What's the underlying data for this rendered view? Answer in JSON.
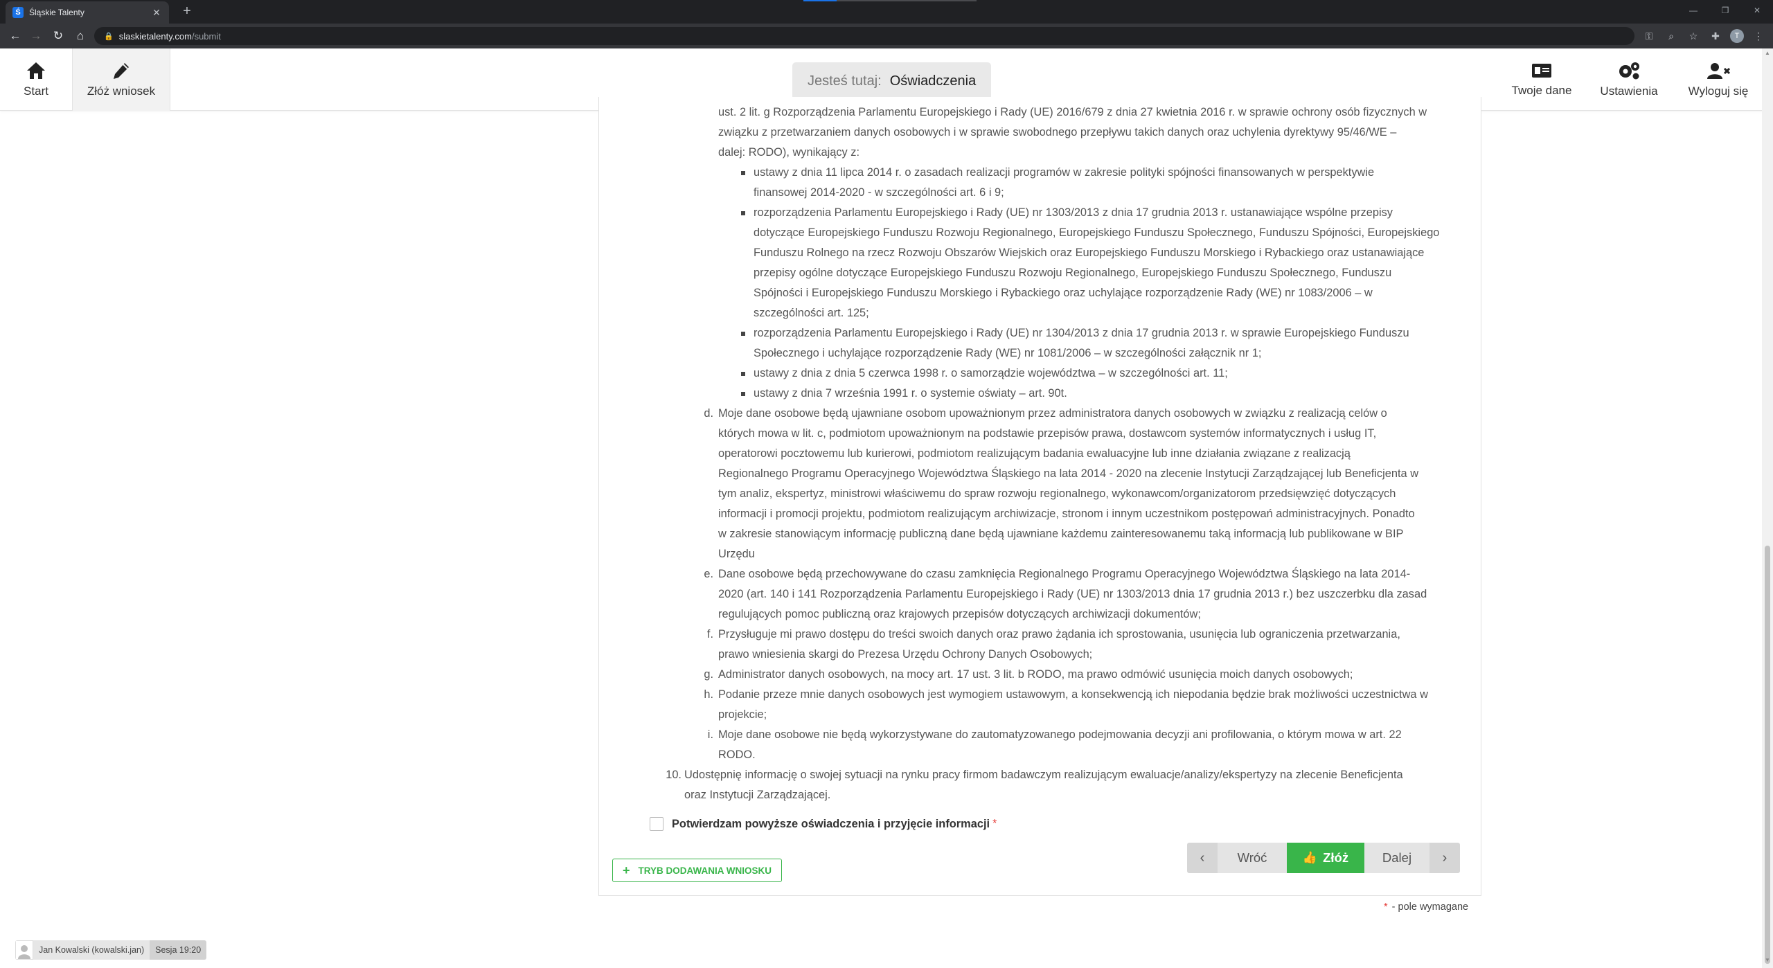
{
  "browser": {
    "tab_title": "Śląskie Talenty",
    "favicon_letter": "Ś",
    "url_host": "slaskietalenty.com",
    "url_path": "/submit",
    "profile_initial": "T"
  },
  "header": {
    "nav_left": [
      {
        "label": "Start",
        "icon": "home-icon"
      },
      {
        "label": "Złóż wniosek",
        "icon": "pencil-icon"
      }
    ],
    "breadcrumb_label": "Jesteś tutaj:",
    "breadcrumb_value": "Oświadczenia",
    "nav_right": [
      {
        "label": "Twoje dane",
        "icon": "id-card-icon"
      },
      {
        "label": "Ustawienia",
        "icon": "gears-icon"
      },
      {
        "label": "Wyloguj się",
        "icon": "user-logout-icon"
      }
    ]
  },
  "content": {
    "lines": [
      "ust. 2 lit. g Rozporządzenia Parlamentu Europejskiego i Rady (UE) 2016/679 z dnia 27 kwietnia 2016 r. w sprawie ochrony osób fizycznych w",
      "związku z przetwarzaniem danych osobowych i w sprawie swobodnego przepływu takich danych oraz uchylenia dyrektywy 95/46/WE –",
      "dalej: RODO), wynikający z:",
      "ustawy z dnia 11 lipca 2014 r. o zasadach realizacji programów w zakresie polityki spójności finansowanych w perspektywie",
      "finansowej 2014-2020 - w szczególności art. 6 i 9;",
      "rozporządzenia Parlamentu Europejskiego i Rady (UE) nr 1303/2013 z dnia 17 grudnia 2013 r. ustanawiające wspólne przepisy",
      "dotyczące Europejskiego Funduszu Rozwoju Regionalnego, Europejskiego Funduszu Społecznego, Funduszu Spójności, Europejskiego",
      "Funduszu Rolnego na rzecz Rozwoju Obszarów Wiejskich oraz Europejskiego Funduszu Morskiego i Rybackiego oraz ustanawiające",
      "przepisy ogólne dotyczące Europejskiego Funduszu Rozwoju Regionalnego, Europejskiego Funduszu Społecznego, Funduszu",
      "Spójności i Europejskiego Funduszu Morskiego i Rybackiego oraz uchylające rozporządzenie Rady (WE) nr 1083/2006 – w",
      "szczególności art. 125;",
      "rozporządzenia Parlamentu Europejskiego i Rady (UE) nr 1304/2013 z dnia 17 grudnia 2013 r. w sprawie Europejskiego Funduszu",
      "Społecznego i uchylające rozporządzenie Rady (WE) nr 1081/2006 – w szczególności załącznik nr 1;",
      "ustawy z dnia z dnia 5 czerwca 1998 r. o samorządzie województwa – w szczególności art. 11;",
      "ustawy z dnia 7 września 1991 r. o systemie oświaty – art. 90t.",
      "Moje dane osobowe będą ujawniane osobom upoważnionym przez administratora danych osobowych w związku z realizacją celów o",
      "których mowa w lit. c, podmiotom upoważnionym na podstawie przepisów prawa, dostawcom systemów informatycznych i usług IT,",
      "operatorowi pocztowemu lub kurierowi, podmiotom realizującym badania ewaluacyjne lub inne działania związane z realizacją",
      "Regionalnego Programu Operacyjnego Województwa Śląskiego na lata 2014 - 2020 na zlecenie Instytucji Zarządzającej lub Beneficjenta w",
      "tym analiz, ekspertyz, ministrowi właściwemu do spraw rozwoju regionalnego, wykonawcom/organizatorom przedsięwzięć dotyczących",
      "informacji i promocji projektu, podmiotom realizującym archiwizacje, stronom i innym uczestnikom postępowań administracyjnych. Ponadto",
      "w zakresie stanowiącym informację publiczną dane będą ujawniane każdemu zainteresowanemu taką informacją lub publikowane w BIP",
      "Urzędu",
      "Dane osobowe będą przechowywane do czasu zamknięcia Regionalnego Programu Operacyjnego Województwa Śląskiego na lata 2014-",
      "2020 (art. 140 i 141 Rozporządzenia Parlamentu Europejskiego i Rady (UE) nr 1303/2013 dnia 17 grudnia 2013 r.) bez uszczerbku dla zasad",
      "regulujących pomoc publiczną oraz krajowych przepisów dotyczących archiwizacji dokumentów;",
      "Przysługuje mi prawo dostępu do treści swoich danych oraz prawo żądania ich sprostowania, usunięcia lub ograniczenia przetwarzania,",
      "prawo wniesienia skargi do Prezesa Urzędu Ochrony Danych Osobowych;",
      "Administrator danych osobowych, na mocy art. 17 ust. 3 lit. b RODO, ma prawo odmówić usunięcia moich danych osobowych;",
      "Podanie przeze mnie danych osobowych jest wymogiem ustawowym, a konsekwencją ich niepodania będzie brak możliwości uczestnictwa w",
      "projekcie;",
      "Moje dane osobowe nie będą wykorzystywane do zautomatyzowanego podejmowania decyzji ani profilowania, o którym mowa w art. 22",
      "RODO.",
      "Udostępnię informację o swojej sytuacji na rynku pracy firmom badawczym realizującym ewaluacje/analizy/ekspertyzy na zlecenie Beneficjenta",
      "oraz Instytucji Zarządzającej."
    ],
    "markers": [
      "d.",
      "e.",
      "f.",
      "g.",
      "h.",
      "i.",
      "10."
    ]
  },
  "form": {
    "confirm_label": "Potwierdzam powyższe oświadczenia i przyjęcie informacji",
    "required_star": "*",
    "mode_button": "TRYB DODAWANIA WNIOSKU",
    "back_label": "Wróć",
    "submit_label": "Złóż",
    "next_label": "Dalej",
    "required_note": "- pole wymagane"
  },
  "status": {
    "user": "Jan Kowalski (kowalski.jan)",
    "session": "Sesja 19:20"
  },
  "colors": {
    "accent_green": "#39b54a",
    "required_red": "#e53935"
  }
}
